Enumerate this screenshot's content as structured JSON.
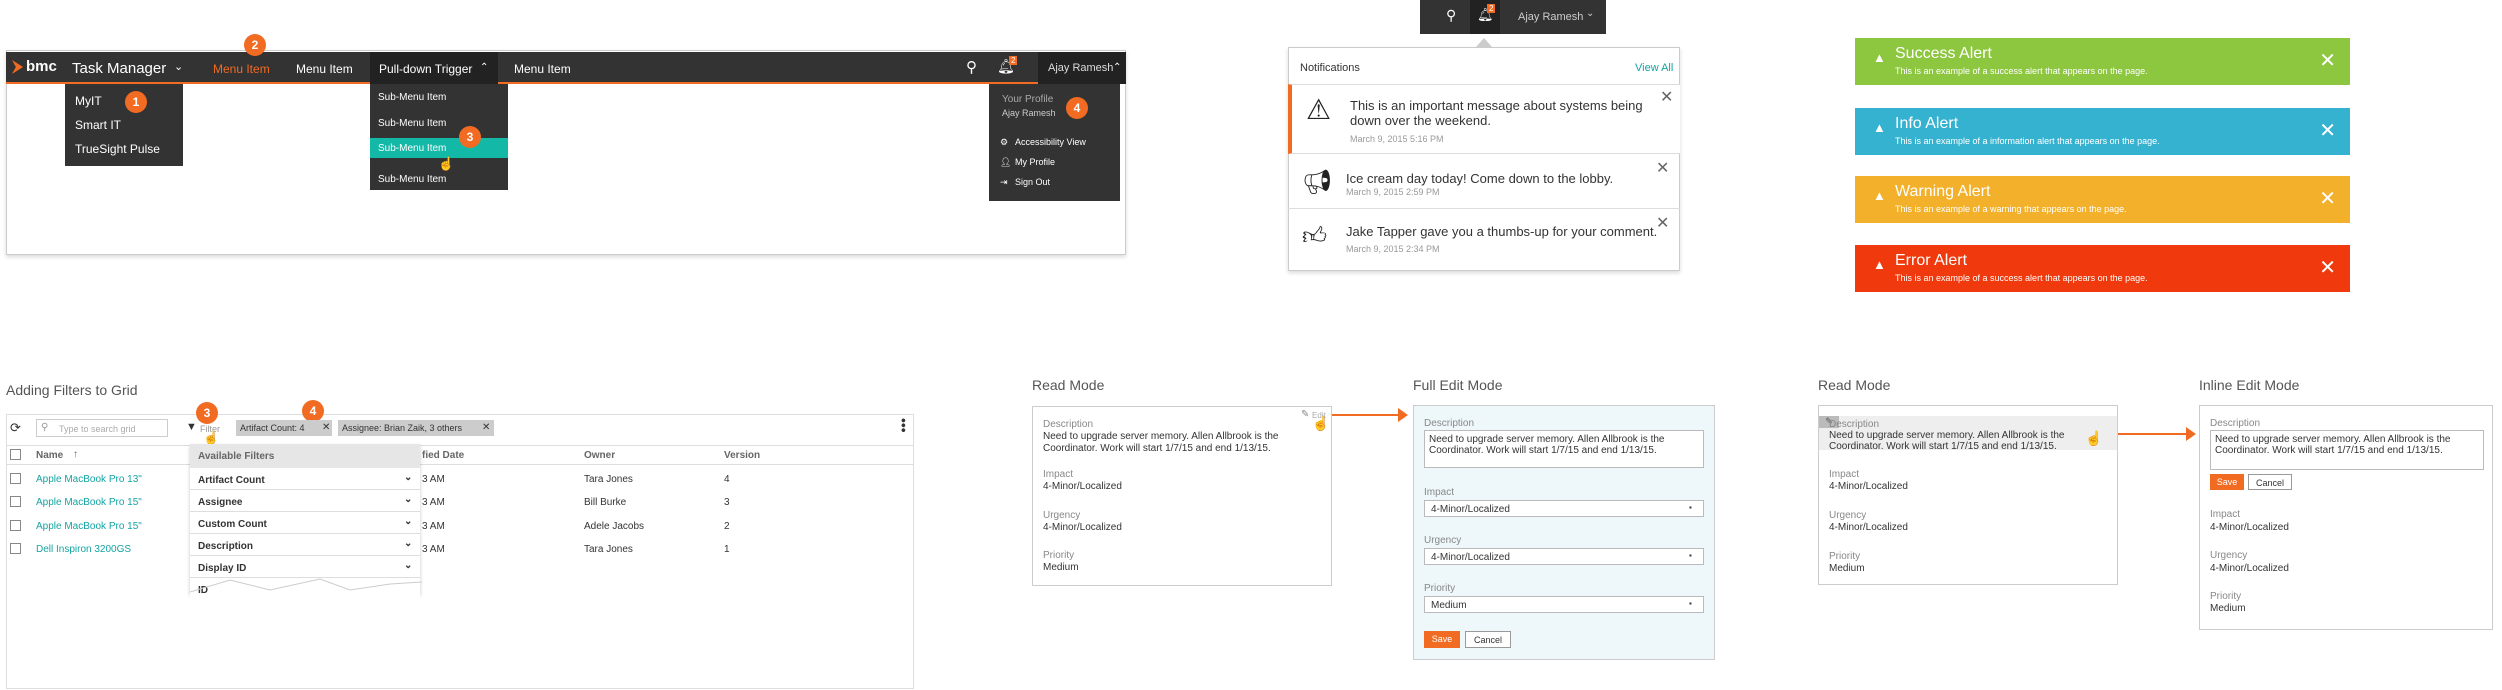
{
  "nav": {
    "brand": "bmc",
    "app_title": "Task Manager",
    "menu1": "Menu Item",
    "menu2": "Menu Item",
    "menu3": "Pull-down Trigger",
    "menu4": "Menu Item",
    "user": "Ajay Ramesh",
    "notif_count": "2",
    "apps": [
      "MyIT",
      "Smart IT",
      "TrueSight Pulse"
    ],
    "subitems": [
      "Sub-Menu Item",
      "Sub-Menu Item",
      "Sub-Menu Item",
      "Sub-Menu Item"
    ],
    "profile_label": "Your Profile",
    "profile_name": "Ajay Ramesh",
    "profile_items": [
      "Accessibility View",
      "My Profile",
      "Sign Out"
    ],
    "badges": [
      "1",
      "2",
      "3",
      "4"
    ]
  },
  "notifications": {
    "topbar_user": "Ajay Ramesh",
    "topbar_count": "2",
    "title": "Notifications",
    "view_all": "View All",
    "items": [
      {
        "text": "This is an important message about systems being down over the weekend.",
        "date": "March 9, 2015 5:16 PM"
      },
      {
        "text": "Ice cream day today! Come down to the lobby.",
        "date": "March 9, 2015 2:59 PM"
      },
      {
        "text": "Jake Tapper gave you a thumbs-up for your comment.",
        "date": "March 9, 2015 2:34 PM"
      }
    ]
  },
  "alerts": [
    {
      "title": "Success Alert",
      "desc": "This is an example of a success alert that appears on the page.",
      "color": "#8dc63f"
    },
    {
      "title": "Info Alert",
      "desc": "This is an example of a information alert that appears on the page.",
      "color": "#35b2d0"
    },
    {
      "title": "Warning Alert",
      "desc": "This is an example of a warning that appears on the page.",
      "color": "#f3b02b"
    },
    {
      "title": "Error Alert",
      "desc": "This is an example of a success alert that appears on the page.",
      "color": "#f0390c"
    }
  ],
  "grid": {
    "section_title": "Adding Filters to Grid",
    "search_placeholder": "Type to search grid",
    "filter_label": "Filter",
    "chip1": "Artifact Count: 4",
    "chip2": "Assignee: Brian Zaik, 3 others",
    "badge3": "3",
    "badge4": "4",
    "columns": [
      "Name",
      "fied Date",
      "Owner",
      "Version"
    ],
    "rows": [
      {
        "name": "Apple MacBook Pro 13\"",
        "date": "3 AM",
        "owner": "Tara Jones",
        "version": "4"
      },
      {
        "name": "Apple MacBook Pro 15\"",
        "date": "3 AM",
        "owner": "Bill Burke",
        "version": "3"
      },
      {
        "name": "Apple MacBook Pro 15\"",
        "date": "3 AM",
        "owner": "Adele Jacobs",
        "version": "2"
      },
      {
        "name": "Dell Inspiron 3200GS",
        "date": "3 AM",
        "owner": "Tara Jones",
        "version": "1"
      }
    ],
    "filters_title": "Available Filters",
    "filters": [
      "Artifact Count",
      "Assignee",
      "Custom Count",
      "Description",
      "Display ID",
      "ID"
    ]
  },
  "edit": {
    "read_mode": "Read Mode",
    "full_edit_mode": "Full Edit Mode",
    "inline_edit_mode": "Inline Edit Mode",
    "edit_label": "Edit",
    "description_label": "Description",
    "description": "Need to upgrade server memory. Allen Allbrook is the Coordinator. Work will start 1/7/15 and end 1/13/15.",
    "impact_label": "Impact",
    "impact": "4-Minor/Localized",
    "urgency_label": "Urgency",
    "urgency": "4-Minor/Localized",
    "priority_label": "Priority",
    "priority": "Medium",
    "save": "Save",
    "cancel": "Cancel"
  },
  "colors": {
    "accent": "#f26b22",
    "teal": "#14b8a6",
    "nav": "#333333"
  }
}
